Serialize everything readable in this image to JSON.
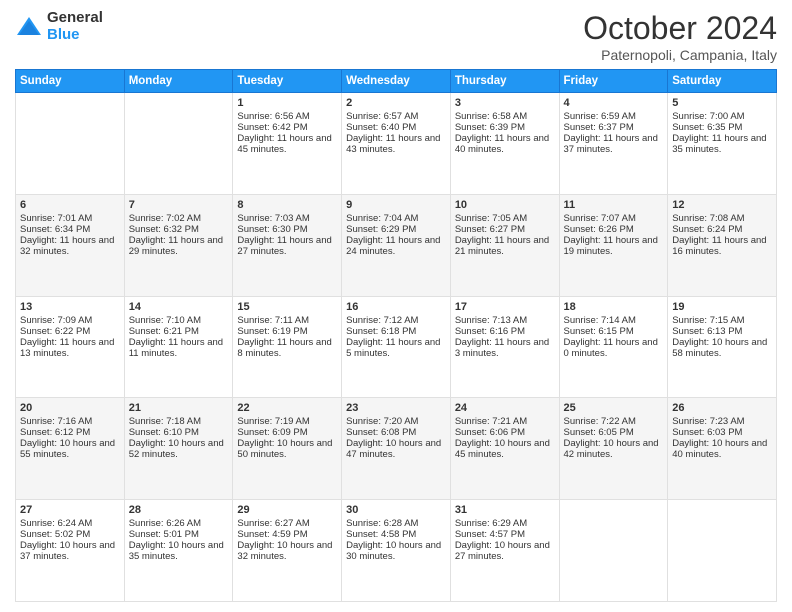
{
  "logo": {
    "general": "General",
    "blue": "Blue"
  },
  "title": {
    "month": "October 2024",
    "location": "Paternopoli, Campania, Italy"
  },
  "weekdays": [
    "Sunday",
    "Monday",
    "Tuesday",
    "Wednesday",
    "Thursday",
    "Friday",
    "Saturday"
  ],
  "weeks": [
    [
      {
        "day": "",
        "sunrise": "",
        "sunset": "",
        "daylight": ""
      },
      {
        "day": "",
        "sunrise": "",
        "sunset": "",
        "daylight": ""
      },
      {
        "day": "1",
        "sunrise": "Sunrise: 6:56 AM",
        "sunset": "Sunset: 6:42 PM",
        "daylight": "Daylight: 11 hours and 45 minutes."
      },
      {
        "day": "2",
        "sunrise": "Sunrise: 6:57 AM",
        "sunset": "Sunset: 6:40 PM",
        "daylight": "Daylight: 11 hours and 43 minutes."
      },
      {
        "day": "3",
        "sunrise": "Sunrise: 6:58 AM",
        "sunset": "Sunset: 6:39 PM",
        "daylight": "Daylight: 11 hours and 40 minutes."
      },
      {
        "day": "4",
        "sunrise": "Sunrise: 6:59 AM",
        "sunset": "Sunset: 6:37 PM",
        "daylight": "Daylight: 11 hours and 37 minutes."
      },
      {
        "day": "5",
        "sunrise": "Sunrise: 7:00 AM",
        "sunset": "Sunset: 6:35 PM",
        "daylight": "Daylight: 11 hours and 35 minutes."
      }
    ],
    [
      {
        "day": "6",
        "sunrise": "Sunrise: 7:01 AM",
        "sunset": "Sunset: 6:34 PM",
        "daylight": "Daylight: 11 hours and 32 minutes."
      },
      {
        "day": "7",
        "sunrise": "Sunrise: 7:02 AM",
        "sunset": "Sunset: 6:32 PM",
        "daylight": "Daylight: 11 hours and 29 minutes."
      },
      {
        "day": "8",
        "sunrise": "Sunrise: 7:03 AM",
        "sunset": "Sunset: 6:30 PM",
        "daylight": "Daylight: 11 hours and 27 minutes."
      },
      {
        "day": "9",
        "sunrise": "Sunrise: 7:04 AM",
        "sunset": "Sunset: 6:29 PM",
        "daylight": "Daylight: 11 hours and 24 minutes."
      },
      {
        "day": "10",
        "sunrise": "Sunrise: 7:05 AM",
        "sunset": "Sunset: 6:27 PM",
        "daylight": "Daylight: 11 hours and 21 minutes."
      },
      {
        "day": "11",
        "sunrise": "Sunrise: 7:07 AM",
        "sunset": "Sunset: 6:26 PM",
        "daylight": "Daylight: 11 hours and 19 minutes."
      },
      {
        "day": "12",
        "sunrise": "Sunrise: 7:08 AM",
        "sunset": "Sunset: 6:24 PM",
        "daylight": "Daylight: 11 hours and 16 minutes."
      }
    ],
    [
      {
        "day": "13",
        "sunrise": "Sunrise: 7:09 AM",
        "sunset": "Sunset: 6:22 PM",
        "daylight": "Daylight: 11 hours and 13 minutes."
      },
      {
        "day": "14",
        "sunrise": "Sunrise: 7:10 AM",
        "sunset": "Sunset: 6:21 PM",
        "daylight": "Daylight: 11 hours and 11 minutes."
      },
      {
        "day": "15",
        "sunrise": "Sunrise: 7:11 AM",
        "sunset": "Sunset: 6:19 PM",
        "daylight": "Daylight: 11 hours and 8 minutes."
      },
      {
        "day": "16",
        "sunrise": "Sunrise: 7:12 AM",
        "sunset": "Sunset: 6:18 PM",
        "daylight": "Daylight: 11 hours and 5 minutes."
      },
      {
        "day": "17",
        "sunrise": "Sunrise: 7:13 AM",
        "sunset": "Sunset: 6:16 PM",
        "daylight": "Daylight: 11 hours and 3 minutes."
      },
      {
        "day": "18",
        "sunrise": "Sunrise: 7:14 AM",
        "sunset": "Sunset: 6:15 PM",
        "daylight": "Daylight: 11 hours and 0 minutes."
      },
      {
        "day": "19",
        "sunrise": "Sunrise: 7:15 AM",
        "sunset": "Sunset: 6:13 PM",
        "daylight": "Daylight: 10 hours and 58 minutes."
      }
    ],
    [
      {
        "day": "20",
        "sunrise": "Sunrise: 7:16 AM",
        "sunset": "Sunset: 6:12 PM",
        "daylight": "Daylight: 10 hours and 55 minutes."
      },
      {
        "day": "21",
        "sunrise": "Sunrise: 7:18 AM",
        "sunset": "Sunset: 6:10 PM",
        "daylight": "Daylight: 10 hours and 52 minutes."
      },
      {
        "day": "22",
        "sunrise": "Sunrise: 7:19 AM",
        "sunset": "Sunset: 6:09 PM",
        "daylight": "Daylight: 10 hours and 50 minutes."
      },
      {
        "day": "23",
        "sunrise": "Sunrise: 7:20 AM",
        "sunset": "Sunset: 6:08 PM",
        "daylight": "Daylight: 10 hours and 47 minutes."
      },
      {
        "day": "24",
        "sunrise": "Sunrise: 7:21 AM",
        "sunset": "Sunset: 6:06 PM",
        "daylight": "Daylight: 10 hours and 45 minutes."
      },
      {
        "day": "25",
        "sunrise": "Sunrise: 7:22 AM",
        "sunset": "Sunset: 6:05 PM",
        "daylight": "Daylight: 10 hours and 42 minutes."
      },
      {
        "day": "26",
        "sunrise": "Sunrise: 7:23 AM",
        "sunset": "Sunset: 6:03 PM",
        "daylight": "Daylight: 10 hours and 40 minutes."
      }
    ],
    [
      {
        "day": "27",
        "sunrise": "Sunrise: 6:24 AM",
        "sunset": "Sunset: 5:02 PM",
        "daylight": "Daylight: 10 hours and 37 minutes."
      },
      {
        "day": "28",
        "sunrise": "Sunrise: 6:26 AM",
        "sunset": "Sunset: 5:01 PM",
        "daylight": "Daylight: 10 hours and 35 minutes."
      },
      {
        "day": "29",
        "sunrise": "Sunrise: 6:27 AM",
        "sunset": "Sunset: 4:59 PM",
        "daylight": "Daylight: 10 hours and 32 minutes."
      },
      {
        "day": "30",
        "sunrise": "Sunrise: 6:28 AM",
        "sunset": "Sunset: 4:58 PM",
        "daylight": "Daylight: 10 hours and 30 minutes."
      },
      {
        "day": "31",
        "sunrise": "Sunrise: 6:29 AM",
        "sunset": "Sunset: 4:57 PM",
        "daylight": "Daylight: 10 hours and 27 minutes."
      },
      {
        "day": "",
        "sunrise": "",
        "sunset": "",
        "daylight": ""
      },
      {
        "day": "",
        "sunrise": "",
        "sunset": "",
        "daylight": ""
      }
    ]
  ]
}
